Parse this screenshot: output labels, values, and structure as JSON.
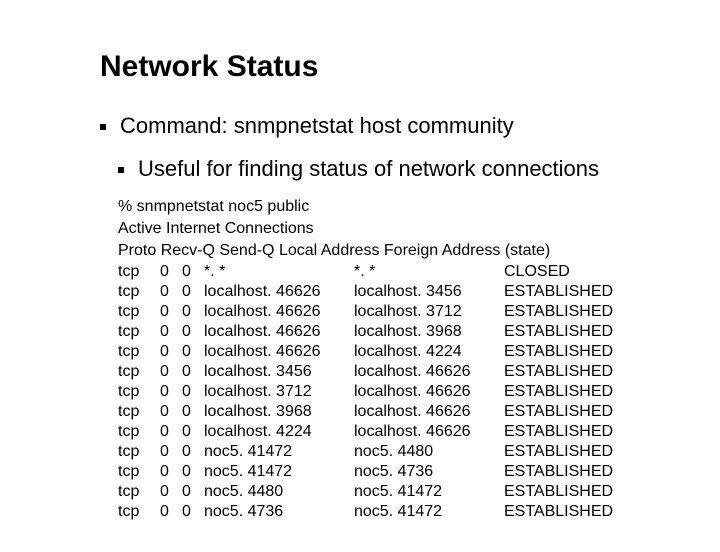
{
  "title": "Network Status",
  "bullets": [
    "Command:  snmpnetstat host community",
    "Useful for finding status of network connections"
  ],
  "terminal": {
    "command": "% snmpnetstat noc5 public",
    "heading": "Active Internet Connections",
    "header": "Proto Recv-Q Send-Q  Local Address Foreign Address (state)",
    "rows": [
      {
        "proto": "tcp",
        "recvq": "0",
        "sendq": "0",
        "local": "*. *",
        "foreign": "*. *",
        "state": "CLOSED"
      },
      {
        "proto": "tcp",
        "recvq": "0",
        "sendq": "0",
        "local": "localhost. 46626",
        "foreign": "localhost. 3456",
        "state": "ESTABLISHED"
      },
      {
        "proto": "tcp",
        "recvq": "0",
        "sendq": "0",
        "local": "localhost. 46626",
        "foreign": "localhost. 3712",
        "state": "ESTABLISHED"
      },
      {
        "proto": "tcp",
        "recvq": "0",
        "sendq": "0",
        "local": "localhost. 46626",
        "foreign": "localhost. 3968",
        "state": "ESTABLISHED"
      },
      {
        "proto": "tcp",
        "recvq": "0",
        "sendq": "0",
        "local": "localhost. 46626",
        "foreign": "localhost. 4224",
        "state": "ESTABLISHED"
      },
      {
        "proto": "tcp",
        "recvq": "0",
        "sendq": "0",
        "local": "localhost. 3456",
        "foreign": "localhost. 46626",
        "state": "ESTABLISHED"
      },
      {
        "proto": "tcp",
        "recvq": "0",
        "sendq": "0",
        "local": "localhost. 3712",
        "foreign": "localhost. 46626",
        "state": "ESTABLISHED"
      },
      {
        "proto": "tcp",
        "recvq": "0",
        "sendq": "0",
        "local": "localhost. 3968",
        "foreign": "localhost. 46626",
        "state": "ESTABLISHED"
      },
      {
        "proto": "tcp",
        "recvq": "0",
        "sendq": "0",
        "local": "localhost. 4224",
        "foreign": "localhost. 46626",
        "state": "ESTABLISHED"
      },
      {
        "proto": "tcp",
        "recvq": "0",
        "sendq": "0",
        "local": "noc5. 41472",
        "foreign": "noc5. 4480",
        "state": "ESTABLISHED"
      },
      {
        "proto": "tcp",
        "recvq": "0",
        "sendq": "0",
        "local": "noc5. 41472",
        "foreign": "noc5. 4736",
        "state": "ESTABLISHED"
      },
      {
        "proto": "tcp",
        "recvq": "0",
        "sendq": "0",
        "local": "noc5. 4480",
        "foreign": "noc5. 41472",
        "state": "ESTABLISHED"
      },
      {
        "proto": "tcp",
        "recvq": "0",
        "sendq": "0",
        "local": "noc5. 4736",
        "foreign": "noc5. 41472",
        "state": "ESTABLISHED"
      }
    ]
  }
}
